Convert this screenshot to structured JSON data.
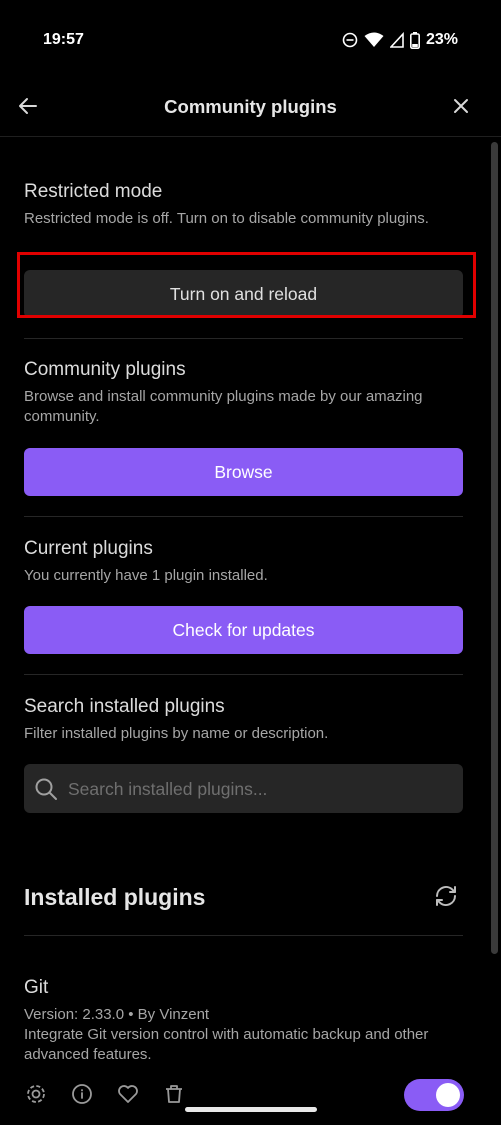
{
  "status_bar": {
    "time": "19:57",
    "battery_percent": "23%"
  },
  "header": {
    "title": "Community plugins"
  },
  "restricted_mode": {
    "title": "Restricted mode",
    "description": "Restricted mode is off. Turn on to disable community plugins.",
    "button_label": "Turn on and reload"
  },
  "community_plugins": {
    "title": "Community plugins",
    "description": "Browse and install community plugins made by our amazing community.",
    "button_label": "Browse"
  },
  "current_plugins": {
    "title": "Current plugins",
    "description": "You currently have 1 plugin installed.",
    "button_label": "Check for updates"
  },
  "search_installed": {
    "title": "Search installed plugins",
    "description": "Filter installed plugins by name or description.",
    "placeholder": "Search installed plugins..."
  },
  "installed": {
    "title": "Installed plugins",
    "plugins": [
      {
        "name": "Git",
        "version_line": "Version: 2.33.0 • By Vinzent",
        "description": "Integrate Git version control with automatic backup and other advanced features.",
        "enabled": true
      }
    ]
  },
  "colors": {
    "accent": "#8a5cf5",
    "highlight": "#e00000",
    "background": "#000000"
  }
}
